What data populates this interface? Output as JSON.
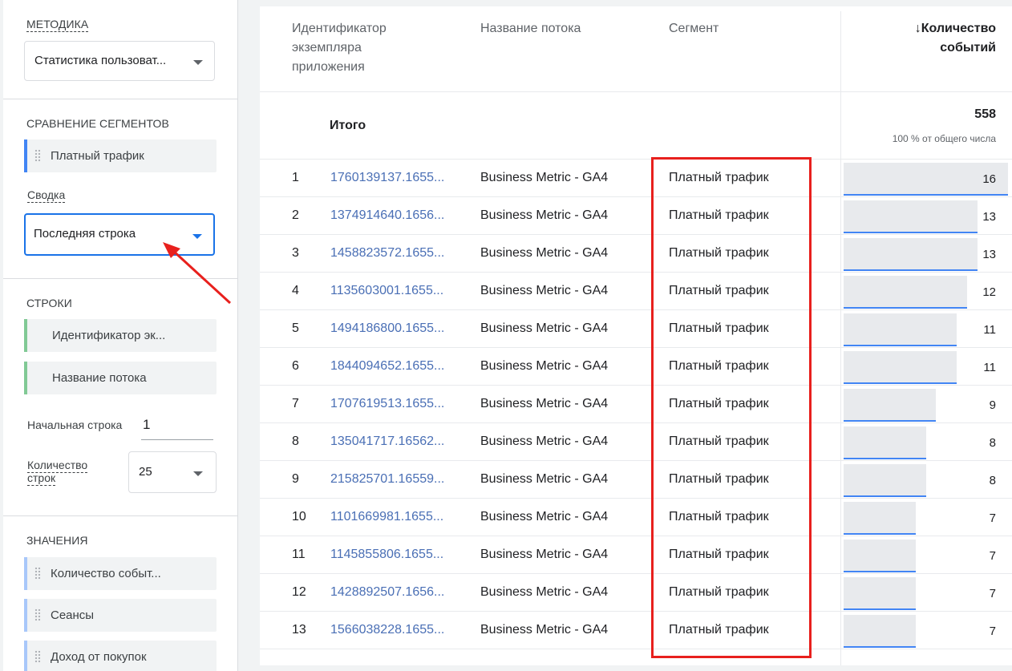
{
  "panel": {
    "technique": {
      "title": "МЕТОДИКА",
      "value": "Статистика пользоват..."
    },
    "segments": {
      "title": "СРАВНЕНИЕ СЕГМЕНТОВ",
      "chip": "Платный трафик",
      "summary_label": "Сводка",
      "summary_value": "Последняя строка"
    },
    "rows": {
      "title": "СТРОКИ",
      "dims": [
        "Идентификатор эк...",
        "Название потока"
      ],
      "start_row_label": "Начальная строка",
      "start_row_value": "1",
      "row_count_label_1": "Количество",
      "row_count_label_2": "строк",
      "row_count_value": "25"
    },
    "values": {
      "title": "ЗНАЧЕНИЯ",
      "metrics": [
        "Количество событ...",
        "Сеансы",
        "Доход от покупок"
      ]
    }
  },
  "table": {
    "headers": {
      "col1_line1": "Идентификатор",
      "col1_line2": "экземпляра",
      "col1_line3": "приложения",
      "col2": "Название потока",
      "col3": "Сегмент",
      "col4_line1": "↓Количество",
      "col4_line2": "событий"
    },
    "total": {
      "label": "Итого",
      "value": "558",
      "share": "100 % от общего числа"
    },
    "rows": [
      {
        "n": "1",
        "id": "1760139137.1655...",
        "stream": "Business Metric - GA4",
        "segment": "Платный трафик",
        "value": 16
      },
      {
        "n": "2",
        "id": "1374914640.1656...",
        "stream": "Business Metric - GA4",
        "segment": "Платный трафик",
        "value": 13
      },
      {
        "n": "3",
        "id": "1458823572.1655...",
        "stream": "Business Metric - GA4",
        "segment": "Платный трафик",
        "value": 13
      },
      {
        "n": "4",
        "id": "1135603001.1655...",
        "stream": "Business Metric - GA4",
        "segment": "Платный трафик",
        "value": 12
      },
      {
        "n": "5",
        "id": "1494186800.1655...",
        "stream": "Business Metric - GA4",
        "segment": "Платный трафик",
        "value": 11
      },
      {
        "n": "6",
        "id": "1844094652.1655...",
        "stream": "Business Metric - GA4",
        "segment": "Платный трафик",
        "value": 11
      },
      {
        "n": "7",
        "id": "1707619513.1655...",
        "stream": "Business Metric - GA4",
        "segment": "Платный трафик",
        "value": 9
      },
      {
        "n": "8",
        "id": "135041717.16562...",
        "stream": "Business Metric - GA4",
        "segment": "Платный трафик",
        "value": 8
      },
      {
        "n": "9",
        "id": "215825701.16559...",
        "stream": "Business Metric - GA4",
        "segment": "Платный трафик",
        "value": 8
      },
      {
        "n": "10",
        "id": "1101669981.1655...",
        "stream": "Business Metric - GA4",
        "segment": "Платный трафик",
        "value": 7
      },
      {
        "n": "11",
        "id": "1145855806.1655...",
        "stream": "Business Metric - GA4",
        "segment": "Платный трафик",
        "value": 7
      },
      {
        "n": "12",
        "id": "1428892507.1656...",
        "stream": "Business Metric - GA4",
        "segment": "Платный трафик",
        "value": 7
      },
      {
        "n": "13",
        "id": "1566038228.1655...",
        "stream": "Business Metric - GA4",
        "segment": "Платный трафик",
        "value": 7
      }
    ]
  },
  "colors": {
    "accent_blue": "#4285f4",
    "highlight_red": "#e8201d",
    "dimension_green": "#81c995",
    "metric_blue": "#a8c7fa",
    "link_blue": "#4a6fb5"
  },
  "icons": [
    "grip-icon",
    "dropdown-caret-icon",
    "sort-arrow-down-icon",
    "annotation-arrow-icon"
  ]
}
